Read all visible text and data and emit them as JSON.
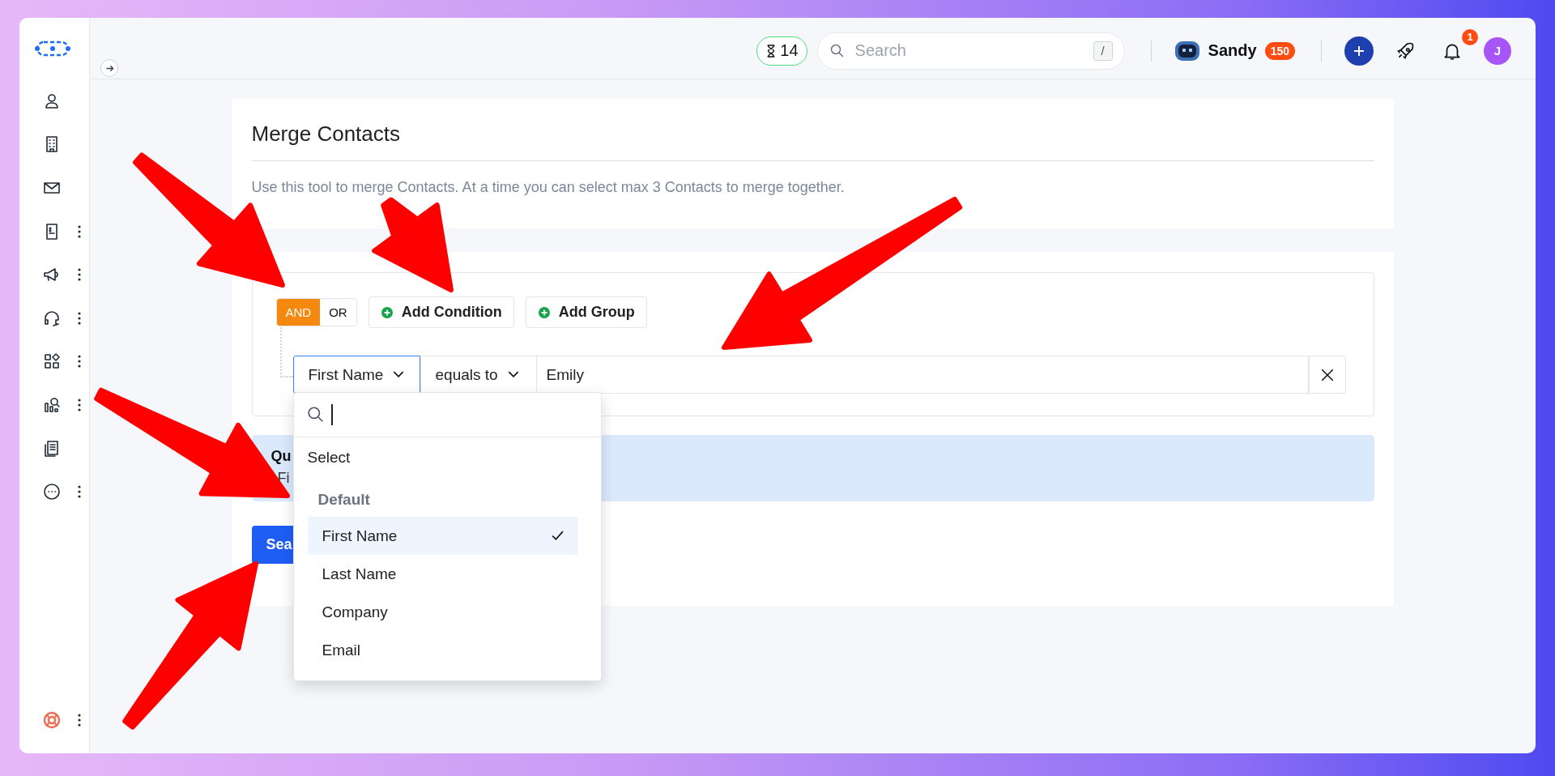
{
  "sidebar": {
    "items": [
      {
        "has_menu": false
      },
      {
        "has_menu": false
      },
      {
        "has_menu": false
      },
      {
        "has_menu": true
      },
      {
        "has_menu": true
      },
      {
        "has_menu": true
      },
      {
        "has_menu": true
      },
      {
        "has_menu": true
      },
      {
        "has_menu": false
      },
      {
        "has_menu": true
      }
    ],
    "help": {
      "has_menu": true
    }
  },
  "topbar": {
    "timer": "14",
    "search": {
      "placeholder": "Search",
      "shortcut": "/"
    },
    "user": "Sandy",
    "points": "150",
    "notifications": "1",
    "avatar": "J"
  },
  "page": {
    "title": "Merge Contacts",
    "description": "Use this tool to merge Contacts. At a time you can select max 3 Contacts to merge together."
  },
  "filter": {
    "logic": [
      {
        "label": "AND",
        "selected": true
      },
      {
        "label": "OR",
        "selected": false
      }
    ],
    "buttons": [
      "Add Condition",
      "Add Group"
    ],
    "condition": {
      "field": "First Name",
      "operator": "equals to",
      "value": "Emily"
    }
  },
  "query": {
    "title": "Qu",
    "text": "Fi"
  },
  "search_button": "Sea",
  "dropdown": {
    "placeholder_option": "Select",
    "group": "Default",
    "options": [
      {
        "label": "First Name",
        "selected": true
      },
      {
        "label": "Last Name",
        "selected": false
      },
      {
        "label": "Company",
        "selected": false
      },
      {
        "label": "Email",
        "selected": false
      }
    ]
  }
}
